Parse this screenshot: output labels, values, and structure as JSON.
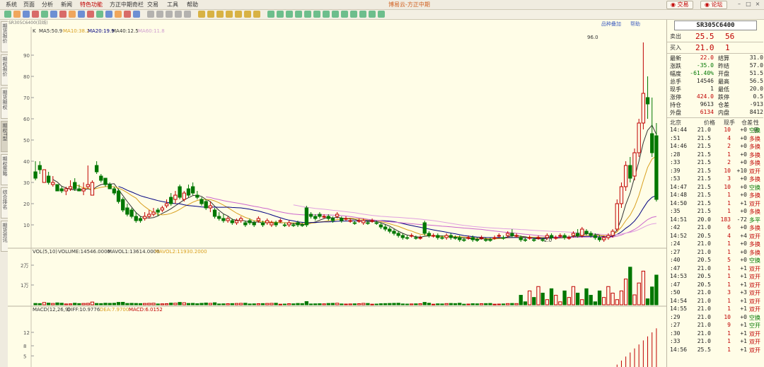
{
  "menu": {
    "items": [
      "系统",
      "页面",
      "分析",
      "新闻",
      "特色功能",
      "方正中期奇栏",
      "交易",
      "工具",
      "帮助"
    ],
    "active_index": 4,
    "app_title": "博易云-方正中期",
    "trade_btn": "交易",
    "forum_btn": "论坛"
  },
  "left_tabs": [
    "期货报价",
    "期权报价",
    "期货期权",
    "期权T型",
    "期权策略",
    "综合排名",
    "期货资讯"
  ],
  "chart": {
    "symbol_info": "SR305C6400(日线)",
    "product_overlay": "品种叠加",
    "help": "帮助",
    "ma_legend": {
      "k": "K",
      "ma5": "MA5:50.9",
      "ma10": "MA10:38.2",
      "ma20": "MA20:19.9",
      "ma40": "MA40:12.5",
      "ma60": "MA60:11.8"
    },
    "high_label": "96.0",
    "low_label": "2.0",
    "price_axis_ticks": [
      "90",
      "80",
      "70",
      "60",
      "50",
      "40",
      "30",
      "20",
      "10"
    ],
    "vol_legend": {
      "name": "VOL(5,10)",
      "volume": "VOLUME:14546.0000",
      "mavol1": "MAVOL1:13614.0000",
      "mavol2": "MAVOL2:11930.2000"
    },
    "vol_axis_ticks": [
      "2万",
      "1万"
    ],
    "macd_legend": {
      "name": "MACD(12,26,9)",
      "diff": "DIFF:10.9776",
      "dea": "DEA:7.9700",
      "macd": "MACD:6.0152"
    },
    "macd_axis_ticks": [
      "12",
      "8",
      "5"
    ],
    "colors": {
      "up": "#c00000",
      "down": "#007700",
      "ma5": "#333333",
      "ma10": "#d9a020",
      "ma20": "#000080",
      "ma40": "#cc66cc",
      "ma60": "#e0a0e0"
    }
  },
  "chart_data": {
    "type": "candlestick",
    "title": "SR305C6400(日线)",
    "ylim": [
      0,
      100
    ],
    "annotations": {
      "high": 96.0,
      "low": 2.0
    },
    "candles_approx": [
      [
        35,
        40,
        32,
        31,
        "d"
      ],
      [
        38,
        40,
        36,
        34,
        "d"
      ],
      [
        36,
        36,
        30,
        33,
        "u"
      ],
      [
        33,
        35,
        30,
        29,
        "d"
      ],
      [
        30,
        33,
        29,
        28,
        "u"
      ],
      [
        29,
        29,
        26,
        27,
        "d"
      ],
      [
        27,
        28,
        26,
        25,
        "d"
      ],
      [
        27,
        28,
        26,
        24,
        "u"
      ],
      [
        28,
        31,
        27,
        26,
        "u"
      ],
      [
        30,
        32,
        27,
        26,
        "d"
      ],
      [
        27,
        29,
        26,
        26,
        "d"
      ],
      [
        26,
        30,
        27,
        24,
        "u"
      ],
      [
        29,
        38,
        28,
        27,
        "u"
      ],
      [
        30,
        31,
        24,
        25,
        "u"
      ],
      [
        38,
        40,
        35,
        34,
        "d"
      ],
      [
        33,
        34,
        31,
        30,
        "d"
      ],
      [
        32,
        32,
        29,
        28,
        "d"
      ],
      [
        29,
        30,
        27,
        27,
        "d"
      ],
      [
        27,
        28,
        25,
        24,
        "d"
      ],
      [
        26,
        27,
        21,
        20,
        "d"
      ],
      [
        22,
        23,
        17,
        16,
        "d"
      ],
      [
        18,
        20,
        15,
        14,
        "d"
      ],
      [
        17,
        18,
        14,
        13,
        "d"
      ],
      [
        14,
        16,
        12,
        11,
        "d"
      ],
      [
        13,
        14,
        12,
        11,
        "d"
      ],
      [
        13,
        16,
        14,
        12,
        "u"
      ],
      [
        15,
        17,
        14,
        13,
        "u"
      ],
      [
        16,
        18,
        15,
        14,
        "u"
      ],
      [
        17,
        18,
        16,
        14,
        "d"
      ],
      [
        17,
        19,
        18,
        16,
        "u"
      ],
      [
        20,
        22,
        19,
        18,
        "u"
      ],
      [
        23,
        25,
        20,
        19,
        "d"
      ],
      [
        24,
        26,
        22,
        20,
        "u"
      ],
      [
        28,
        29,
        23,
        22,
        "d"
      ],
      [
        22,
        26,
        25,
        21,
        "u"
      ],
      [
        27,
        29,
        24,
        23,
        "d"
      ],
      [
        28,
        30,
        25,
        24,
        "d"
      ],
      [
        24,
        26,
        23,
        22,
        "d"
      ],
      [
        22,
        23,
        20,
        19,
        "d"
      ],
      [
        21,
        22,
        18,
        17,
        "d"
      ],
      [
        18,
        21,
        19,
        16,
        "u"
      ],
      [
        17,
        18,
        14,
        13,
        "d"
      ],
      [
        14,
        16,
        13,
        12,
        "d"
      ],
      [
        13,
        15,
        12,
        11,
        "d"
      ],
      [
        12,
        14,
        13,
        11,
        "u"
      ],
      [
        12,
        13,
        11,
        10,
        "d"
      ],
      [
        11,
        13,
        12,
        10,
        "u"
      ],
      [
        12,
        14,
        13,
        11,
        "u"
      ],
      [
        11,
        12,
        10,
        9,
        "d"
      ],
      [
        12,
        13,
        11,
        10,
        "d"
      ],
      [
        11,
        12,
        10,
        9,
        "d"
      ],
      [
        12,
        14,
        13,
        11,
        "u"
      ],
      [
        11,
        12,
        10,
        9,
        "d"
      ],
      [
        11,
        13,
        12,
        10,
        "u"
      ],
      [
        10,
        12,
        11,
        9,
        "u"
      ],
      [
        11,
        12,
        10,
        9,
        "d"
      ],
      [
        12,
        13,
        12,
        11,
        "u"
      ],
      [
        10,
        11,
        10,
        9,
        "d"
      ],
      [
        10,
        12,
        11,
        9,
        "u"
      ],
      [
        10,
        11,
        10,
        9,
        "d"
      ],
      [
        11,
        12,
        10,
        9,
        "d"
      ],
      [
        10,
        11,
        10,
        9,
        "d"
      ],
      [
        18,
        19,
        10,
        9,
        "d"
      ],
      [
        15,
        16,
        14,
        13,
        "d"
      ],
      [
        14,
        15,
        13,
        12,
        "d"
      ],
      [
        15,
        16,
        14,
        13,
        "d"
      ],
      [
        14,
        15,
        14,
        13,
        "u"
      ],
      [
        14,
        15,
        13,
        12,
        "d"
      ],
      [
        13,
        14,
        12,
        11,
        "d"
      ],
      [
        14,
        16,
        15,
        13,
        "u"
      ],
      [
        13,
        14,
        12,
        11,
        "d"
      ],
      [
        13,
        14,
        13,
        12,
        "u"
      ],
      [
        12,
        13,
        12,
        11,
        "u"
      ],
      [
        11,
        12,
        11,
        10,
        "d"
      ],
      [
        12,
        13,
        12,
        11,
        "u"
      ],
      [
        11,
        13,
        12,
        10,
        "u"
      ],
      [
        11,
        12,
        11,
        10,
        "d"
      ],
      [
        12,
        13,
        12,
        11,
        "u"
      ],
      [
        11,
        12,
        11,
        10,
        "d"
      ],
      [
        10,
        11,
        9,
        8,
        "d"
      ],
      [
        9,
        10,
        8,
        7,
        "d"
      ],
      [
        8,
        9,
        7,
        6,
        "d"
      ],
      [
        7,
        8,
        6,
        5,
        "d"
      ],
      [
        6,
        7,
        5,
        4,
        "d"
      ],
      [
        5,
        6,
        4,
        3,
        "d"
      ],
      [
        4,
        5,
        4,
        3,
        "d"
      ],
      [
        5,
        6,
        5,
        4,
        "u"
      ],
      [
        4,
        5,
        4,
        3,
        "d"
      ],
      [
        4,
        5,
        4,
        3,
        "u"
      ],
      [
        11,
        12,
        6,
        5,
        "d"
      ],
      [
        6,
        7,
        5,
        4,
        "d"
      ],
      [
        5,
        6,
        5,
        4,
        "u"
      ],
      [
        5,
        6,
        4,
        3,
        "d"
      ],
      [
        4,
        5,
        4,
        3,
        "d"
      ],
      [
        4,
        6,
        5,
        3,
        "u"
      ],
      [
        5,
        6,
        4,
        3,
        "d"
      ],
      [
        4,
        5,
        4,
        3,
        "d"
      ],
      [
        4,
        5,
        3,
        2,
        "d"
      ],
      [
        3,
        4,
        3,
        2,
        "d"
      ],
      [
        4,
        5,
        4,
        3,
        "u"
      ],
      [
        4,
        5,
        3,
        2,
        "d"
      ],
      [
        3,
        4,
        3,
        2,
        "d"
      ],
      [
        4,
        5,
        4,
        3,
        "u"
      ],
      [
        3,
        4,
        3,
        2,
        "d"
      ],
      [
        3,
        4,
        3,
        2,
        "d"
      ],
      [
        4,
        5,
        4,
        3,
        "u"
      ],
      [
        5,
        6,
        5,
        4,
        "u"
      ],
      [
        4,
        5,
        4,
        3,
        "d"
      ],
      [
        5,
        7,
        6,
        4,
        "u"
      ],
      [
        6,
        8,
        5,
        4,
        "d"
      ],
      [
        5,
        6,
        5,
        4,
        "u"
      ],
      [
        4,
        5,
        3,
        2,
        "d"
      ],
      [
        3,
        4,
        3,
        2,
        "d"
      ],
      [
        4,
        5,
        4,
        3,
        "u"
      ],
      [
        3,
        4,
        3,
        2,
        "d"
      ],
      [
        4,
        5,
        4,
        3,
        "u"
      ],
      [
        3,
        4,
        3,
        2,
        "d"
      ],
      [
        4,
        6,
        5,
        3,
        "u"
      ],
      [
        5,
        6,
        4,
        3,
        "d"
      ],
      [
        4,
        5,
        4,
        3,
        "u"
      ],
      [
        5,
        6,
        5,
        4,
        "u"
      ],
      [
        5,
        6,
        4,
        3,
        "d"
      ],
      [
        4,
        5,
        4,
        3,
        "u"
      ],
      [
        5,
        7,
        6,
        4,
        "u"
      ],
      [
        6,
        8,
        5,
        4,
        "d"
      ],
      [
        5,
        9,
        8,
        4,
        "u"
      ],
      [
        7,
        8,
        6,
        5,
        "d"
      ],
      [
        6,
        7,
        5,
        4,
        "d"
      ],
      [
        5,
        6,
        4,
        3,
        "d"
      ],
      [
        4,
        5,
        3,
        2,
        "d"
      ],
      [
        3,
        5,
        4,
        2,
        "u"
      ],
      [
        4,
        6,
        5,
        3,
        "u"
      ],
      [
        5,
        8,
        7,
        4,
        "u"
      ],
      [
        8,
        22,
        20,
        7,
        "u"
      ],
      [
        20,
        30,
        28,
        18,
        "u"
      ],
      [
        28,
        40,
        38,
        26,
        "u"
      ],
      [
        38,
        42,
        32,
        30,
        "d"
      ],
      [
        33,
        46,
        44,
        31,
        "u"
      ],
      [
        44,
        60,
        58,
        42,
        "u"
      ],
      [
        58,
        96,
        72,
        55,
        "u"
      ],
      [
        70,
        80,
        67,
        60,
        "d"
      ],
      [
        53,
        70,
        44,
        42,
        "d"
      ],
      [
        52,
        58,
        22,
        21,
        "d"
      ]
    ]
  },
  "quote": {
    "code": "SR305C6400",
    "sell": {
      "label": "卖出",
      "price": "25.5",
      "volume": "56"
    },
    "buy": {
      "label": "买入",
      "price": "21.0",
      "volume": "1"
    },
    "stats": [
      {
        "l1": "最新",
        "v1": "22.0",
        "c1": "red",
        "l2": "结算",
        "v2": "31.0",
        "c2": "black"
      },
      {
        "l1": "涨跌",
        "v1": "-35.0",
        "c1": "green",
        "l2": "昨结",
        "v2": "57.0",
        "c2": "black"
      },
      {
        "l1": "幅度",
        "v1": "-61.40%",
        "c1": "green",
        "l2": "开盘",
        "v2": "51.5",
        "c2": "black"
      },
      {
        "l1": "总手",
        "v1": "14546",
        "c1": "black",
        "l2": "最高",
        "v2": "56.5",
        "c2": "black"
      },
      {
        "l1": "现手",
        "v1": "1",
        "c1": "black",
        "l2": "最低",
        "v2": "20.0",
        "c2": "black"
      },
      {
        "l1": "涨停",
        "v1": "424.0",
        "c1": "red",
        "l2": "跌停",
        "v2": "0.5",
        "c2": "black"
      },
      {
        "l1": "持仓",
        "v1": "9613",
        "c1": "black",
        "l2": "仓差",
        "v2": "-913",
        "c2": "black"
      },
      {
        "l1": "外盘",
        "v1": "6134",
        "c1": "red",
        "l2": "内盘",
        "v2": "8412",
        "c2": "black"
      }
    ],
    "tick_header": {
      "region": "北京",
      "price": "价格",
      "volume": "现手",
      "oi": "仓差",
      "nature": "性质"
    },
    "ticks": [
      {
        "t": "14:44",
        "p": "21.0",
        "v": "10",
        "o": "+0",
        "n": "空换",
        "nc": "green"
      },
      {
        "t": ":51",
        "p": "21.5",
        "v": "4",
        "o": "+0",
        "n": "多换",
        "nc": "red"
      },
      {
        "t": "14:46",
        "p": "21.5",
        "v": "2",
        "o": "+0",
        "n": "多换",
        "nc": "red"
      },
      {
        "t": ":28",
        "p": "21.5",
        "v": "1",
        "o": "+0",
        "n": "多换",
        "nc": "red"
      },
      {
        "t": ":33",
        "p": "21.5",
        "v": "2",
        "o": "+0",
        "n": "多换",
        "nc": "red"
      },
      {
        "t": ":39",
        "p": "21.5",
        "v": "10",
        "o": "+10",
        "n": "双开",
        "nc": "red"
      },
      {
        "t": ":53",
        "p": "21.5",
        "v": "3",
        "o": "+0",
        "n": "多换",
        "nc": "red"
      },
      {
        "t": "14:47",
        "p": "21.5",
        "v": "10",
        "o": "+0",
        "n": "空换",
        "nc": "green"
      },
      {
        "t": "14:48",
        "p": "21.5",
        "v": "1",
        "o": "+0",
        "n": "多换",
        "nc": "red"
      },
      {
        "t": "14:50",
        "p": "21.5",
        "v": "1",
        "o": "+1",
        "n": "双开",
        "nc": "red"
      },
      {
        "t": ":35",
        "p": "21.5",
        "v": "1",
        "o": "+0",
        "n": "多换",
        "nc": "red"
      },
      {
        "t": "14:51",
        "p": "20.0",
        "v": "183",
        "o": "-72",
        "n": "多平",
        "nc": "green"
      },
      {
        "t": ":42",
        "p": "21.0",
        "v": "6",
        "o": "+0",
        "n": "多换",
        "nc": "red"
      },
      {
        "t": "14:52",
        "p": "20.5",
        "v": "4",
        "o": "+4",
        "n": "双开",
        "nc": "red"
      },
      {
        "t": ":24",
        "p": "21.0",
        "v": "1",
        "o": "+0",
        "n": "多换",
        "nc": "red"
      },
      {
        "t": ":27",
        "p": "21.0",
        "v": "1",
        "o": "+0",
        "n": "多换",
        "nc": "red"
      },
      {
        "t": ":40",
        "p": "20.5",
        "v": "5",
        "o": "+0",
        "n": "空换",
        "nc": "green"
      },
      {
        "t": ":47",
        "p": "21.0",
        "v": "1",
        "o": "+1",
        "n": "双开",
        "nc": "red"
      },
      {
        "t": "14:53",
        "p": "20.5",
        "v": "1",
        "o": "+1",
        "n": "双开",
        "nc": "red"
      },
      {
        "t": ":47",
        "p": "20.5",
        "v": "1",
        "o": "+1",
        "n": "双开",
        "nc": "red"
      },
      {
        "t": ":50",
        "p": "21.0",
        "v": "3",
        "o": "+3",
        "n": "双开",
        "nc": "red"
      },
      {
        "t": "14:54",
        "p": "21.0",
        "v": "1",
        "o": "+1",
        "n": "双开",
        "nc": "red"
      },
      {
        "t": "14:55",
        "p": "21.0",
        "v": "1",
        "o": "+1",
        "n": "双开",
        "nc": "red"
      },
      {
        "t": ":29",
        "p": "21.0",
        "v": "10",
        "o": "+0",
        "n": "空换",
        "nc": "green"
      },
      {
        "t": ":27",
        "p": "21.0",
        "v": "9",
        "o": "+1",
        "n": "空开",
        "nc": "green"
      },
      {
        "t": ":30",
        "p": "21.0",
        "v": "1",
        "o": "+1",
        "n": "双开",
        "nc": "red"
      },
      {
        "t": ":33",
        "p": "21.0",
        "v": "1",
        "o": "+1",
        "n": "双开",
        "nc": "red"
      },
      {
        "t": "14:56",
        "p": "25.5",
        "v": "1",
        "o": "+1",
        "n": "双开",
        "nc": "red"
      }
    ]
  }
}
